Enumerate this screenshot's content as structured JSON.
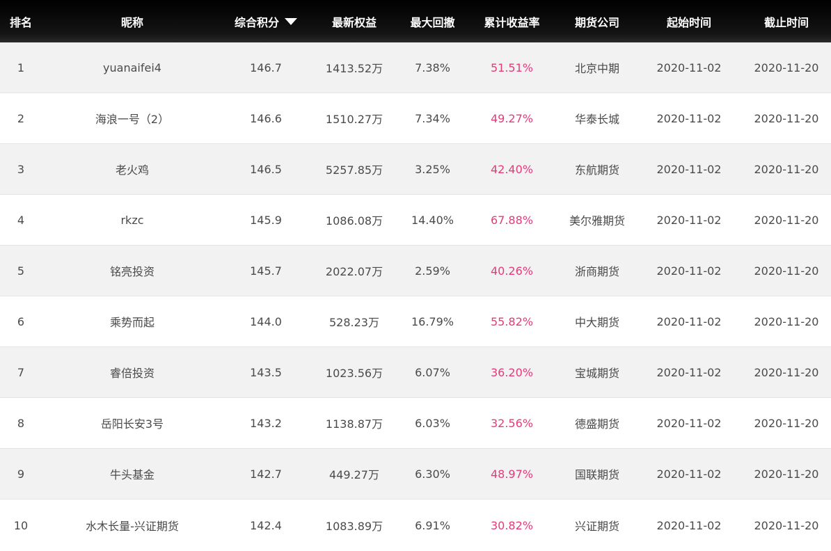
{
  "columns": {
    "rank": "排名",
    "name": "昵称",
    "score": "综合积分",
    "equity": "最新权益",
    "drawdown": "最大回撤",
    "return": "累计收益率",
    "company": "期货公司",
    "start": "起始时间",
    "end": "截止时间"
  },
  "colors": {
    "header_bg": "#000000",
    "return_text": "#e23b7a",
    "row_alt": "#f2f2f2"
  },
  "sort": {
    "column": "score",
    "direction": "desc",
    "icon": "caret-down-icon"
  },
  "rows": [
    {
      "rank": "1",
      "name": "yuanaifei4",
      "score": "146.7",
      "equity": "1413.52万",
      "drawdown": "7.38%",
      "return": "51.51%",
      "company": "北京中期",
      "start": "2020-11-02",
      "end": "2020-11-20"
    },
    {
      "rank": "2",
      "name": "海浪一号（2）",
      "score": "146.6",
      "equity": "1510.27万",
      "drawdown": "7.34%",
      "return": "49.27%",
      "company": "华泰长城",
      "start": "2020-11-02",
      "end": "2020-11-20"
    },
    {
      "rank": "3",
      "name": "老火鸡",
      "score": "146.5",
      "equity": "5257.85万",
      "drawdown": "3.25%",
      "return": "42.40%",
      "company": "东航期货",
      "start": "2020-11-02",
      "end": "2020-11-20"
    },
    {
      "rank": "4",
      "name": "rkzc",
      "score": "145.9",
      "equity": "1086.08万",
      "drawdown": "14.40%",
      "return": "67.88%",
      "company": "美尔雅期货",
      "start": "2020-11-02",
      "end": "2020-11-20"
    },
    {
      "rank": "5",
      "name": "铭亮投资",
      "score": "145.7",
      "equity": "2022.07万",
      "drawdown": "2.59%",
      "return": "40.26%",
      "company": "浙商期货",
      "start": "2020-11-02",
      "end": "2020-11-20"
    },
    {
      "rank": "6",
      "name": "乘势而起",
      "score": "144.0",
      "equity": "528.23万",
      "drawdown": "16.79%",
      "return": "55.82%",
      "company": "中大期货",
      "start": "2020-11-02",
      "end": "2020-11-20"
    },
    {
      "rank": "7",
      "name": "睿倍投资",
      "score": "143.5",
      "equity": "1023.56万",
      "drawdown": "6.07%",
      "return": "36.20%",
      "company": "宝城期货",
      "start": "2020-11-02",
      "end": "2020-11-20"
    },
    {
      "rank": "8",
      "name": "岳阳长安3号",
      "score": "143.2",
      "equity": "1138.87万",
      "drawdown": "6.03%",
      "return": "32.56%",
      "company": "德盛期货",
      "start": "2020-11-02",
      "end": "2020-11-20"
    },
    {
      "rank": "9",
      "name": "牛头基金",
      "score": "142.7",
      "equity": "449.27万",
      "drawdown": "6.30%",
      "return": "48.97%",
      "company": "国联期货",
      "start": "2020-11-02",
      "end": "2020-11-20"
    },
    {
      "rank": "10",
      "name": "水木长量-兴证期货",
      "score": "142.4",
      "equity": "1083.89万",
      "drawdown": "6.91%",
      "return": "30.82%",
      "company": "兴证期货",
      "start": "2020-11-02",
      "end": "2020-11-20"
    }
  ]
}
